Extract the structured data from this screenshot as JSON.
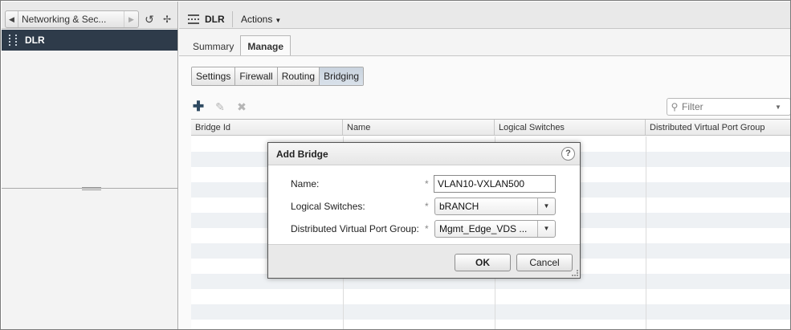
{
  "nav": {
    "breadcrumb_label": "Networking & Sec...",
    "selected_item": "DLR",
    "back_icon": "chevron-left-icon",
    "forward_icon": "chevron-right-icon",
    "history_icon": "history-icon",
    "pin_icon": "pin-icon"
  },
  "header": {
    "object_title": "DLR",
    "actions_label": "Actions"
  },
  "tabs": [
    {
      "label": "Summary",
      "active": false
    },
    {
      "label": "Manage",
      "active": true
    }
  ],
  "subtabs": [
    {
      "label": "Settings",
      "active": false
    },
    {
      "label": "Firewall",
      "active": false
    },
    {
      "label": "Routing",
      "active": false
    },
    {
      "label": "Bridging",
      "active": true
    }
  ],
  "toolbar": {
    "add_icon": "add-icon",
    "edit_icon": "edit-icon",
    "delete_icon": "delete-icon"
  },
  "filter": {
    "placeholder": "Filter"
  },
  "grid": {
    "columns": [
      "Bridge Id",
      "Name",
      "Logical Switches",
      "Distributed Virtual Port Group"
    ],
    "rows": []
  },
  "dialog": {
    "title": "Add Bridge",
    "help": "?",
    "required_marker": "*",
    "fields": {
      "name": {
        "label": "Name:",
        "value": "VLAN10-VXLAN500"
      },
      "logical_switches": {
        "label": "Logical Switches:",
        "value": "bRANCH"
      },
      "dvpg": {
        "label": "Distributed Virtual Port Group:",
        "value": "Mgmt_Edge_VDS ..."
      }
    },
    "ok_label": "OK",
    "cancel_label": "Cancel"
  },
  "colors": {
    "nav_selected_bg": "#2e3b4a",
    "active_subtab_bg": "#c9d3de",
    "add_icon": "#2f4a62"
  }
}
